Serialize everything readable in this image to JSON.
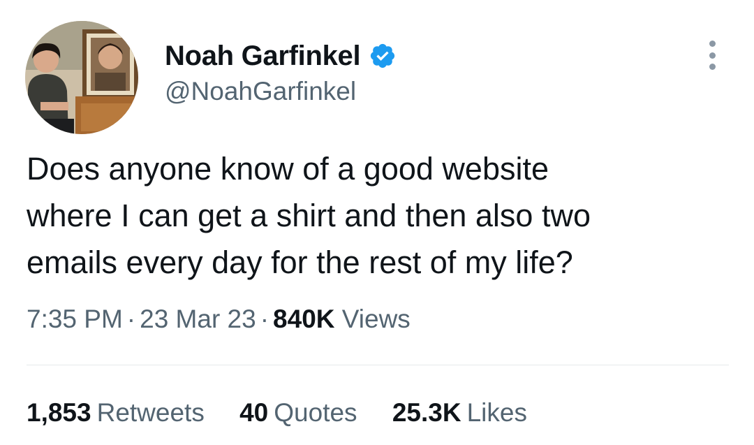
{
  "author": {
    "display_name": "Noah Garfinkel",
    "handle": "@NoahGarfinkel",
    "verified_icon": "verified-badge-icon",
    "avatar_icon": "avatar"
  },
  "tweet": {
    "text_lines": [
      "Does anyone know of a good website",
      "where I can get a shirt and then also two",
      "emails every day for the rest of my life?"
    ]
  },
  "meta": {
    "time": "7:35 PM",
    "separator": "·",
    "date": "23 Mar 23",
    "views_count": "840K",
    "views_label": "Views"
  },
  "stats": {
    "retweets_count": "1,853",
    "retweets_label": "Retweets",
    "quotes_count": "40",
    "quotes_label": "Quotes",
    "likes_count": "25.3K",
    "likes_label": "Likes"
  },
  "colors": {
    "text_primary": "#0f1419",
    "text_secondary": "#536471",
    "verified_blue": "#1d9bf0",
    "divider": "#e6e9eb"
  }
}
